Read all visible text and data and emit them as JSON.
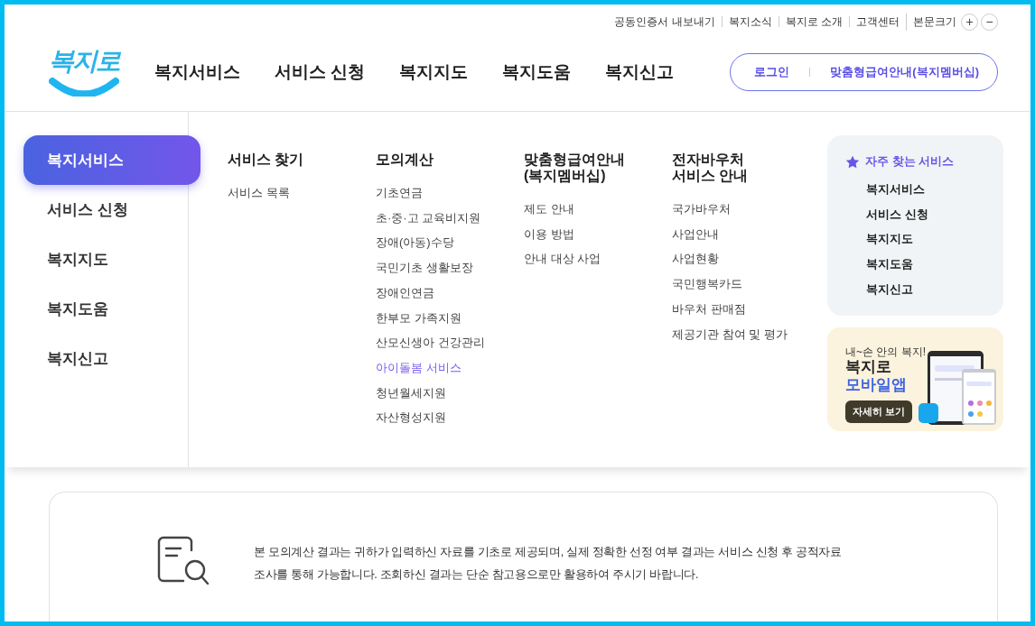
{
  "utility_links": [
    {
      "label": "공동인증서 내보내기"
    },
    {
      "label": "복지소식"
    },
    {
      "label": "복지로 소개"
    },
    {
      "label": "고객센터"
    }
  ],
  "font_size": {
    "label": "본문크기",
    "plus": "+",
    "minus": "−"
  },
  "logo": {
    "text": "복지로"
  },
  "nav": [
    {
      "label": "복지서비스"
    },
    {
      "label": "서비스 신청"
    },
    {
      "label": "복지지도"
    },
    {
      "label": "복지도움"
    },
    {
      "label": "복지신고"
    }
  ],
  "account": {
    "login": "로그인",
    "membership": "맞춤형급여안내(복지멤버십)"
  },
  "menu_sidebar": [
    {
      "label": "복지서비스",
      "selected": true
    },
    {
      "label": "서비스 신청",
      "selected": false
    },
    {
      "label": "복지지도",
      "selected": false
    },
    {
      "label": "복지도움",
      "selected": false
    },
    {
      "label": "복지신고",
      "selected": false
    }
  ],
  "menu_columns": [
    {
      "title": "서비스 찾기",
      "links": [
        {
          "label": "서비스 목록",
          "selected": false
        }
      ]
    },
    {
      "title": "모의계산",
      "links": [
        {
          "label": "기초연금",
          "selected": false
        },
        {
          "label": "초·중·고 교육비지원",
          "selected": false
        },
        {
          "label": "장애(아동)수당",
          "selected": false
        },
        {
          "label": "국민기초 생활보장",
          "selected": false
        },
        {
          "label": "장애인연금",
          "selected": false
        },
        {
          "label": "한부모 가족지원",
          "selected": false
        },
        {
          "label": "산모신생아 건강관리",
          "selected": false
        },
        {
          "label": "아이돌봄 서비스",
          "selected": true
        },
        {
          "label": "청년월세지원",
          "selected": false
        },
        {
          "label": "자산형성지원",
          "selected": false
        }
      ]
    },
    {
      "title": "맞춤형급여안내\n(복지멤버십)",
      "links": [
        {
          "label": "제도 안내",
          "selected": false
        },
        {
          "label": "이용 방법",
          "selected": false
        },
        {
          "label": "안내 대상 사업",
          "selected": false
        }
      ]
    },
    {
      "title": "전자바우처\n서비스 안내",
      "links": [
        {
          "label": "국가바우처",
          "selected": false
        },
        {
          "label": "사업안내",
          "selected": false
        },
        {
          "label": "사업현황",
          "selected": false
        },
        {
          "label": "국민행복카드",
          "selected": false
        },
        {
          "label": "바우처 판매점",
          "selected": false
        },
        {
          "label": "제공기관 참여 및 평가",
          "selected": false
        }
      ]
    }
  ],
  "favorites": {
    "title": "자주 찾는 서비스",
    "items": [
      {
        "label": "복지서비스"
      },
      {
        "label": "서비스 신청"
      },
      {
        "label": "복지지도"
      },
      {
        "label": "복지도움"
      },
      {
        "label": "복지신고"
      }
    ]
  },
  "app_promo": {
    "tagline": "내~손 안의 복지!",
    "title": "복지로",
    "subtitle": "모바일앱",
    "button": "자세히 보기"
  },
  "notice": {
    "text": "본 모의계산 결과는 귀하가 입력하신 자료를 기초로 제공되며, 실제 정확한 선정 여부 결과는 서비스 신청 후 공적자료 조사를 통해 가능합니다. 조회하신 결과는 단순 참고용으로만 활용하여 주시기 바랍니다."
  }
}
